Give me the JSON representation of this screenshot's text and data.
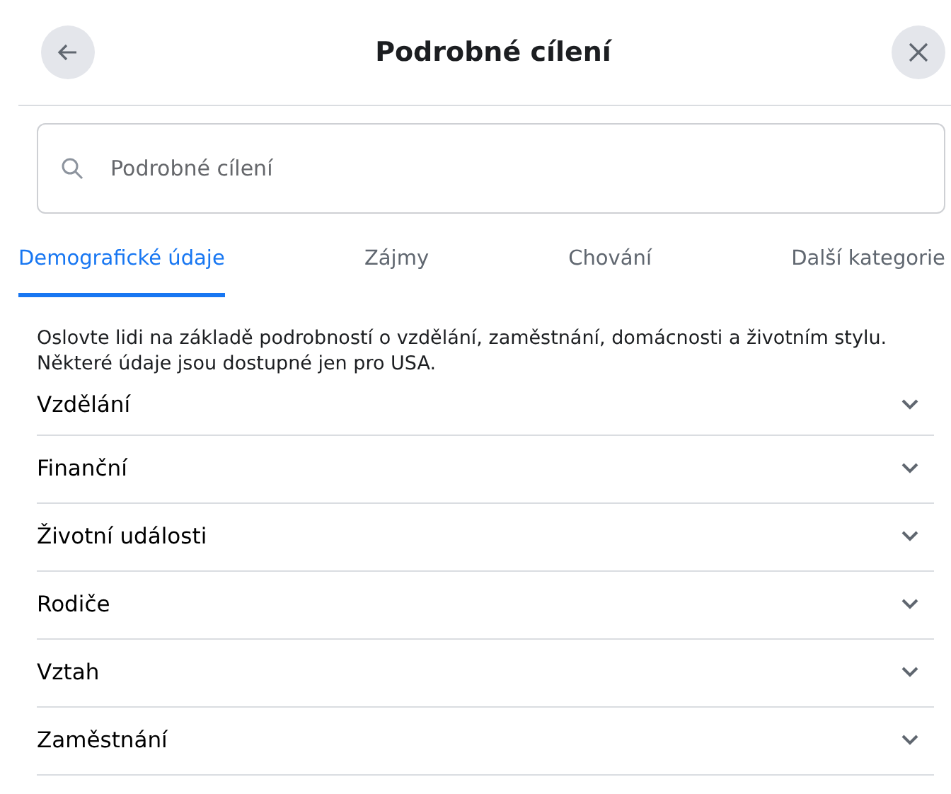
{
  "header": {
    "title": "Podrobné cílení"
  },
  "search": {
    "placeholder": "Podrobné cílení"
  },
  "tabs": [
    {
      "label": "Demografické údaje",
      "selected": true
    },
    {
      "label": "Zájmy",
      "selected": false
    },
    {
      "label": "Chování",
      "selected": false
    },
    {
      "label": "Další kategorie",
      "selected": false
    }
  ],
  "description": "Oslovte lidi na základě podrobností o vzdělání, zaměstnání, domácnosti a životním stylu. Některé údaje jsou dostupné jen pro USA.",
  "categories": [
    {
      "label": "Vzdělání",
      "expanded": false
    },
    {
      "label": "Finanční",
      "expanded": false
    },
    {
      "label": "Životní události",
      "expanded": false
    },
    {
      "label": "Rodiče",
      "expanded": false
    },
    {
      "label": "Vztah",
      "expanded": false
    },
    {
      "label": "Zaměstnání",
      "expanded": false
    }
  ]
}
